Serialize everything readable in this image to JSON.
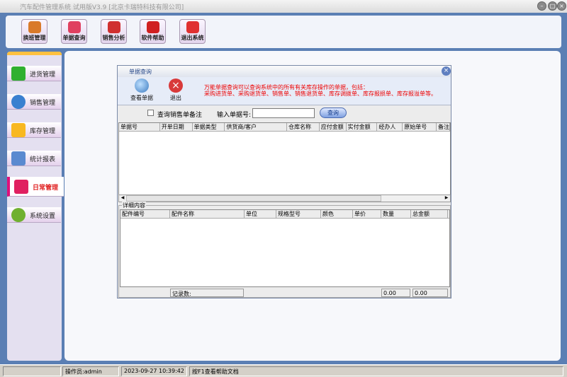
{
  "window": {
    "title": "汽车配件管理系统 试用版V3.9 [北京卡瑞特科技有限公司]"
  },
  "toolbar": [
    {
      "label": "换班管理",
      "icon": "users-icon",
      "color": "#d97a2a"
    },
    {
      "label": "单据查询",
      "icon": "magnifier-icon",
      "color": "#e04060"
    },
    {
      "label": "销售分析",
      "icon": "bar-chart-icon",
      "color": "#d03030"
    },
    {
      "label": "软件帮助",
      "icon": "help-icon",
      "color": "#d02020"
    },
    {
      "label": "退出系统",
      "icon": "power-icon",
      "color": "#e03030"
    }
  ],
  "sidebar": [
    {
      "label": "进货管理",
      "icon": "plus-icon",
      "color": "#30b030"
    },
    {
      "label": "销售管理",
      "icon": "pie-chart-icon",
      "color": "#3a80d0"
    },
    {
      "label": "库存管理",
      "icon": "star-icon",
      "color": "#f8b820"
    },
    {
      "label": "统计报表",
      "icon": "bar-chart-icon",
      "color": "#5a8ad0"
    },
    {
      "label": "日常管理",
      "icon": "tools-icon",
      "color": "#e02060",
      "active": true
    },
    {
      "label": "系统设置",
      "icon": "gear-icon",
      "color": "#70b030"
    }
  ],
  "dialog": {
    "title": "单据查询",
    "view_button": "查看单据",
    "exit_button": "退出",
    "notice_line1": "万能单据查询可以查询系统中的所有有关库存操作的单据，包括：",
    "notice_line2": "采购进货单、采购退货单、销售单、销售退货单、库存调拨单、库存报损单、库存报溢单等。",
    "checkbox_label": "查询销售单备注",
    "checkbox_checked": false,
    "input_label": "输入单据号:",
    "input_value": "",
    "query_button": "查询",
    "columns": [
      "单据号",
      "开单日期",
      "单据类型",
      "供货商/客户",
      "仓库名称",
      "应付金额",
      "实付金额",
      "经办人",
      "原始单号",
      "备注"
    ],
    "rows": [],
    "detail_group": "详细内容",
    "detail_columns": [
      "配件编号",
      "配件名称",
      "单位",
      "规格型号",
      "颜色",
      "单价",
      "数量",
      "总金额"
    ],
    "detail_rows": [],
    "record_label": "记录数:",
    "total_qty": "0.00",
    "total_amount": "0.00"
  },
  "status": {
    "operator": "操作员:admin",
    "datetime": "2023-09-27 10:39:42",
    "hint": "按F1查看帮助文档"
  }
}
